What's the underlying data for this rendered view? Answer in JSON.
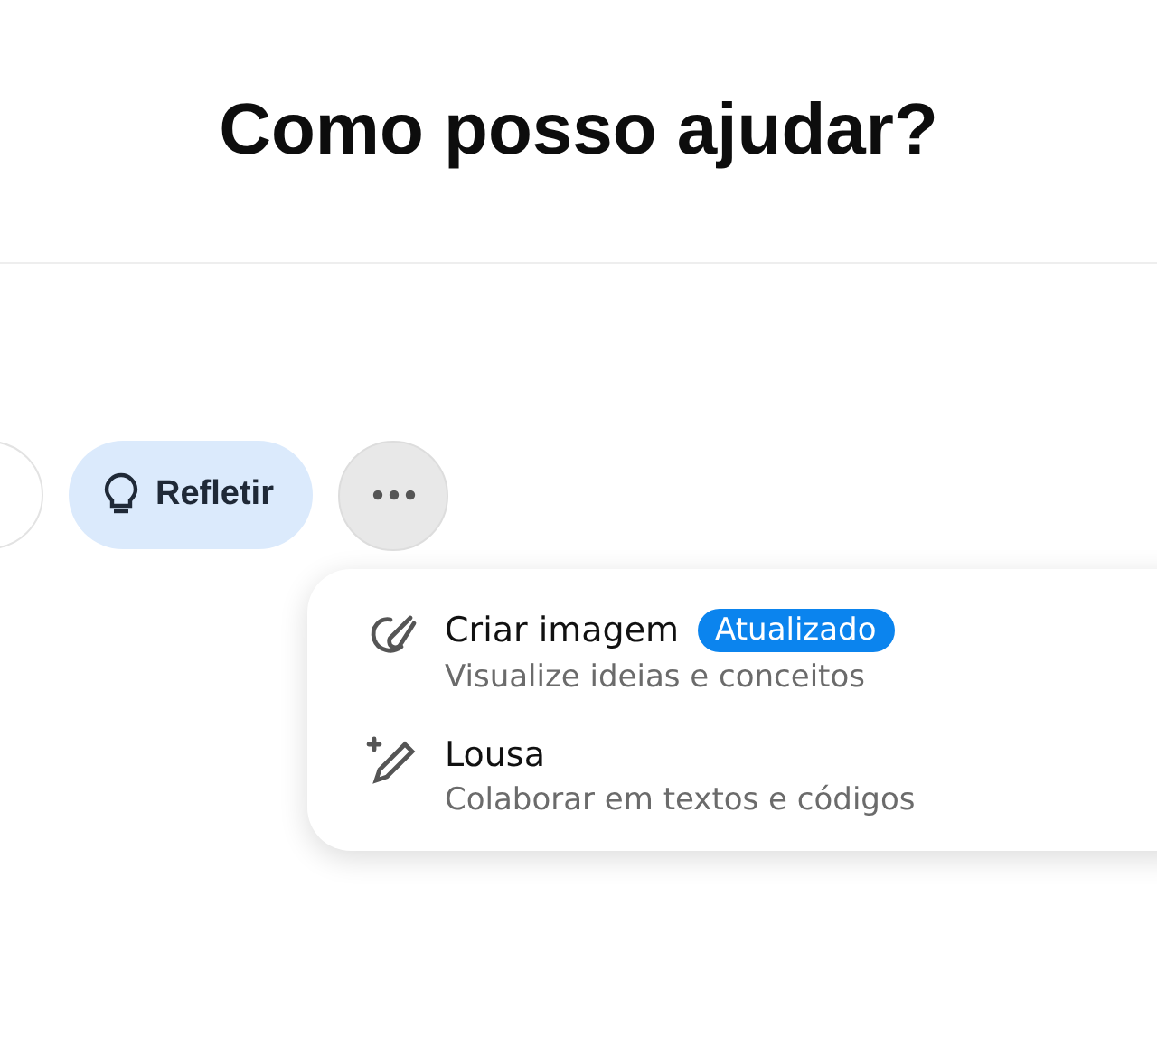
{
  "heading": "Como posso ajudar?",
  "actions": [
    {
      "kind": "partial"
    },
    {
      "kind": "pill",
      "label": "Refletir",
      "selected": true
    },
    {
      "kind": "more",
      "expanded": true
    }
  ],
  "menu": [
    {
      "kind": "image",
      "title": "Criar imagem",
      "badge": "Atualizado",
      "subtitle": "Visualize ideias e conceitos"
    },
    {
      "kind": "canvas",
      "title": "Lousa",
      "subtitle": "Colaborar em textos e códigos"
    }
  ]
}
